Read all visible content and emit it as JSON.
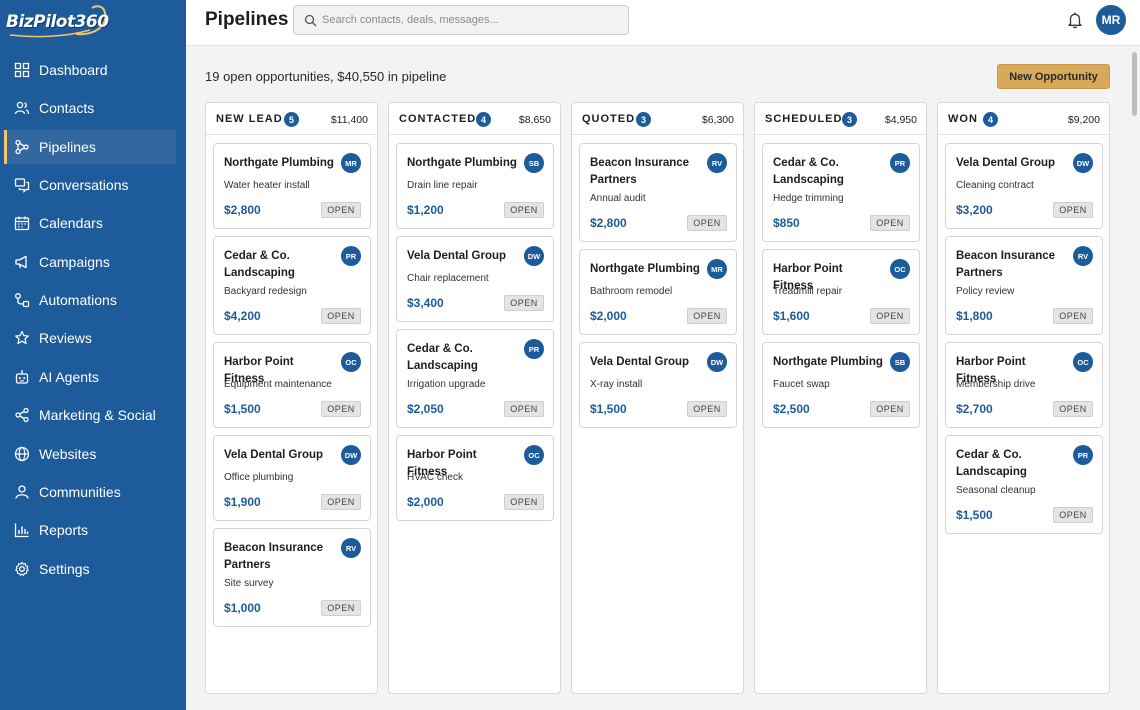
{
  "brand": {
    "logo_text": "BizPilot360"
  },
  "sidebar": {
    "items": [
      {
        "label": "Dashboard",
        "icon": "grid-icon",
        "active": false
      },
      {
        "label": "Contacts",
        "icon": "users-icon",
        "active": false
      },
      {
        "label": "Pipelines",
        "icon": "pipeline-icon",
        "active": true
      },
      {
        "label": "Conversations",
        "icon": "chat-icon",
        "active": false
      },
      {
        "label": "Calendars",
        "icon": "calendar-icon",
        "active": false
      },
      {
        "label": "Campaigns",
        "icon": "megaphone-icon",
        "active": false
      },
      {
        "label": "Automations",
        "icon": "automation-icon",
        "active": false
      },
      {
        "label": "Reviews",
        "icon": "star-icon",
        "active": false
      },
      {
        "label": "AI Agents",
        "icon": "robot-icon",
        "active": false
      },
      {
        "label": "Marketing & Social",
        "icon": "share-icon",
        "active": false
      },
      {
        "label": "Websites",
        "icon": "globe-icon",
        "active": false
      },
      {
        "label": "Communities",
        "icon": "community-icon",
        "active": false
      },
      {
        "label": "Reports",
        "icon": "bar-chart-icon",
        "active": false
      },
      {
        "label": "Settings",
        "icon": "gear-icon",
        "active": false
      }
    ]
  },
  "header": {
    "title": "Pipelines",
    "search_placeholder": "Search contacts, deals, messages...",
    "user_initials": "MR"
  },
  "main": {
    "summary": "19 open opportunities, $40,550 in pipeline",
    "new_button": "New Opportunity"
  },
  "colors": {
    "primary": "#1d5b9b",
    "accent": "#d9a95a",
    "active_indicator": "#f2c46b"
  },
  "columns": [
    {
      "title": "NEW LEAD",
      "count": "5",
      "total": "$11,400",
      "cards": [
        {
          "company": "Northgate Plumbing",
          "initials": "MR",
          "desc": "Water heater install",
          "amount": "$2,800",
          "status": "OPEN"
        },
        {
          "company": "Cedar & Co. Landscaping",
          "initials": "PR",
          "desc": "Backyard redesign",
          "amount": "$4,200",
          "status": "OPEN"
        },
        {
          "company": "Harbor Point Fitness",
          "initials": "OC",
          "desc": "Equipment maintenance",
          "amount": "$1,500",
          "status": "OPEN"
        },
        {
          "company": "Vela Dental Group",
          "initials": "DW",
          "desc": "Office plumbing",
          "amount": "$1,900",
          "status": "OPEN"
        },
        {
          "company": "Beacon Insurance Partners",
          "initials": "RV",
          "desc": "Site survey",
          "amount": "$1,000",
          "status": "OPEN"
        }
      ]
    },
    {
      "title": "CONTACTED",
      "count": "4",
      "total": "$8,650",
      "cards": [
        {
          "company": "Northgate Plumbing",
          "initials": "SB",
          "desc": "Drain line repair",
          "amount": "$1,200",
          "status": "OPEN"
        },
        {
          "company": "Vela Dental Group",
          "initials": "DW",
          "desc": "Chair replacement",
          "amount": "$3,400",
          "status": "OPEN"
        },
        {
          "company": "Cedar & Co. Landscaping",
          "initials": "PR",
          "desc": "Irrigation upgrade",
          "amount": "$2,050",
          "status": "OPEN"
        },
        {
          "company": "Harbor Point Fitness",
          "initials": "OC",
          "desc": "HVAC check",
          "amount": "$2,000",
          "status": "OPEN"
        }
      ]
    },
    {
      "title": "QUOTED",
      "count": "3",
      "total": "$6,300",
      "cards": [
        {
          "company": "Beacon Insurance Partners",
          "initials": "RV",
          "desc": "Annual audit",
          "amount": "$2,800",
          "status": "OPEN"
        },
        {
          "company": "Northgate Plumbing",
          "initials": "MR",
          "desc": "Bathroom remodel",
          "amount": "$2,000",
          "status": "OPEN"
        },
        {
          "company": "Vela Dental Group",
          "initials": "DW",
          "desc": "X-ray install",
          "amount": "$1,500",
          "status": "OPEN"
        }
      ]
    },
    {
      "title": "SCHEDULED",
      "count": "3",
      "total": "$4,950",
      "cards": [
        {
          "company": "Cedar & Co. Landscaping",
          "initials": "PR",
          "desc": "Hedge trimming",
          "amount": "$850",
          "status": "OPEN"
        },
        {
          "company": "Harbor Point Fitness",
          "initials": "OC",
          "desc": "Treadmill repair",
          "amount": "$1,600",
          "status": "OPEN"
        },
        {
          "company": "Northgate Plumbing",
          "initials": "SB",
          "desc": "Faucet swap",
          "amount": "$2,500",
          "status": "OPEN"
        }
      ]
    },
    {
      "title": "WON",
      "count": "4",
      "total": "$9,200",
      "cards": [
        {
          "company": "Vela Dental Group",
          "initials": "DW",
          "desc": "Cleaning contract",
          "amount": "$3,200",
          "status": "OPEN"
        },
        {
          "company": "Beacon Insurance Partners",
          "initials": "RV",
          "desc": "Policy review",
          "amount": "$1,800",
          "status": "OPEN"
        },
        {
          "company": "Harbor Point Fitness",
          "initials": "OC",
          "desc": "Membership drive",
          "amount": "$2,700",
          "status": "OPEN"
        },
        {
          "company": "Cedar & Co. Landscaping",
          "initials": "PR",
          "desc": "Seasonal cleanup",
          "amount": "$1,500",
          "status": "OPEN"
        }
      ]
    }
  ]
}
